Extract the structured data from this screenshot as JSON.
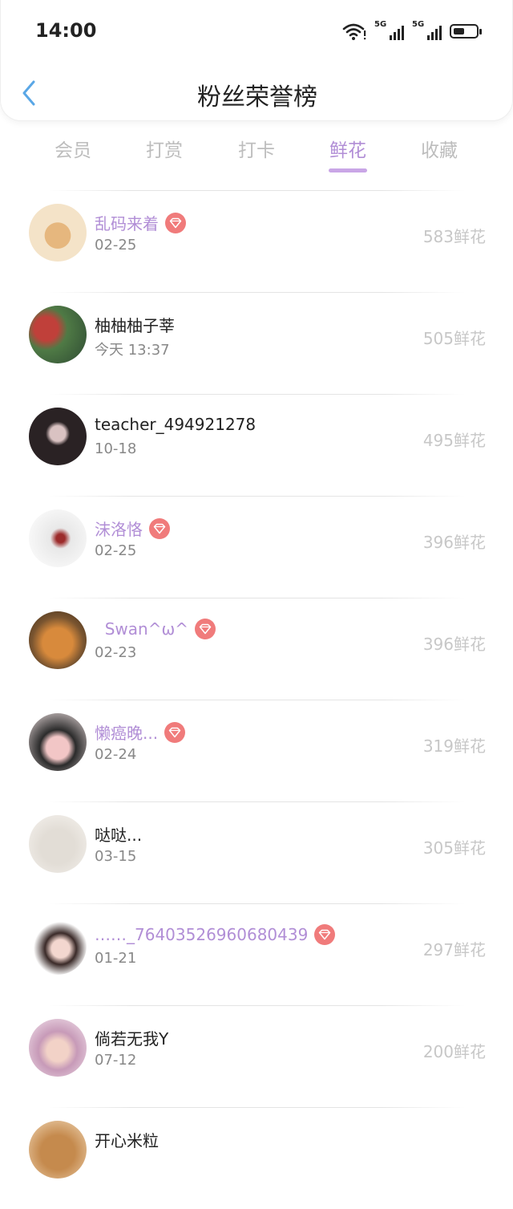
{
  "status_bar": {
    "time": "14:00",
    "signal1": "5G",
    "signal2": "5G",
    "battery_level": 0.45
  },
  "header": {
    "title": "粉丝荣誉榜",
    "back_icon": "chevron-left-icon"
  },
  "tabs": [
    {
      "label": "会员",
      "active": false
    },
    {
      "label": "打赏",
      "active": false
    },
    {
      "label": "打卡",
      "active": false
    },
    {
      "label": "鲜花",
      "active": true
    },
    {
      "label": "收藏",
      "active": false
    }
  ],
  "accent_color": "#b18ed6",
  "vip_badge_color": "#f07b7b",
  "fans": [
    {
      "name": "乱码来着",
      "date": "02-25",
      "count": "583鲜花",
      "vip": true
    },
    {
      "name": "柚柚柚子莘",
      "date": "今天 13:37",
      "count": "505鲜花",
      "vip": false
    },
    {
      "name": "teacher_494921278",
      "date": "10-18",
      "count": "495鲜花",
      "vip": false
    },
    {
      "name": "沫洛恪",
      "date": "02-25",
      "count": "396鲜花",
      "vip": true
    },
    {
      "name": "  Swan^ω^",
      "date": "02-23",
      "count": "396鲜花",
      "vip": true
    },
    {
      "name": "懒癌晚...",
      "date": "02-24",
      "count": "319鲜花",
      "vip": true
    },
    {
      "name": "哒哒...",
      "date": "03-15",
      "count": "305鲜花",
      "vip": false
    },
    {
      "name": "……_76403526960680439",
      "date": "01-21",
      "count": "297鲜花",
      "vip": true
    },
    {
      "name": "倘若无我Y",
      "date": "07-12",
      "count": "200鲜花",
      "vip": false
    },
    {
      "name": "开心米粒",
      "date": "",
      "count": "",
      "vip": false
    }
  ]
}
